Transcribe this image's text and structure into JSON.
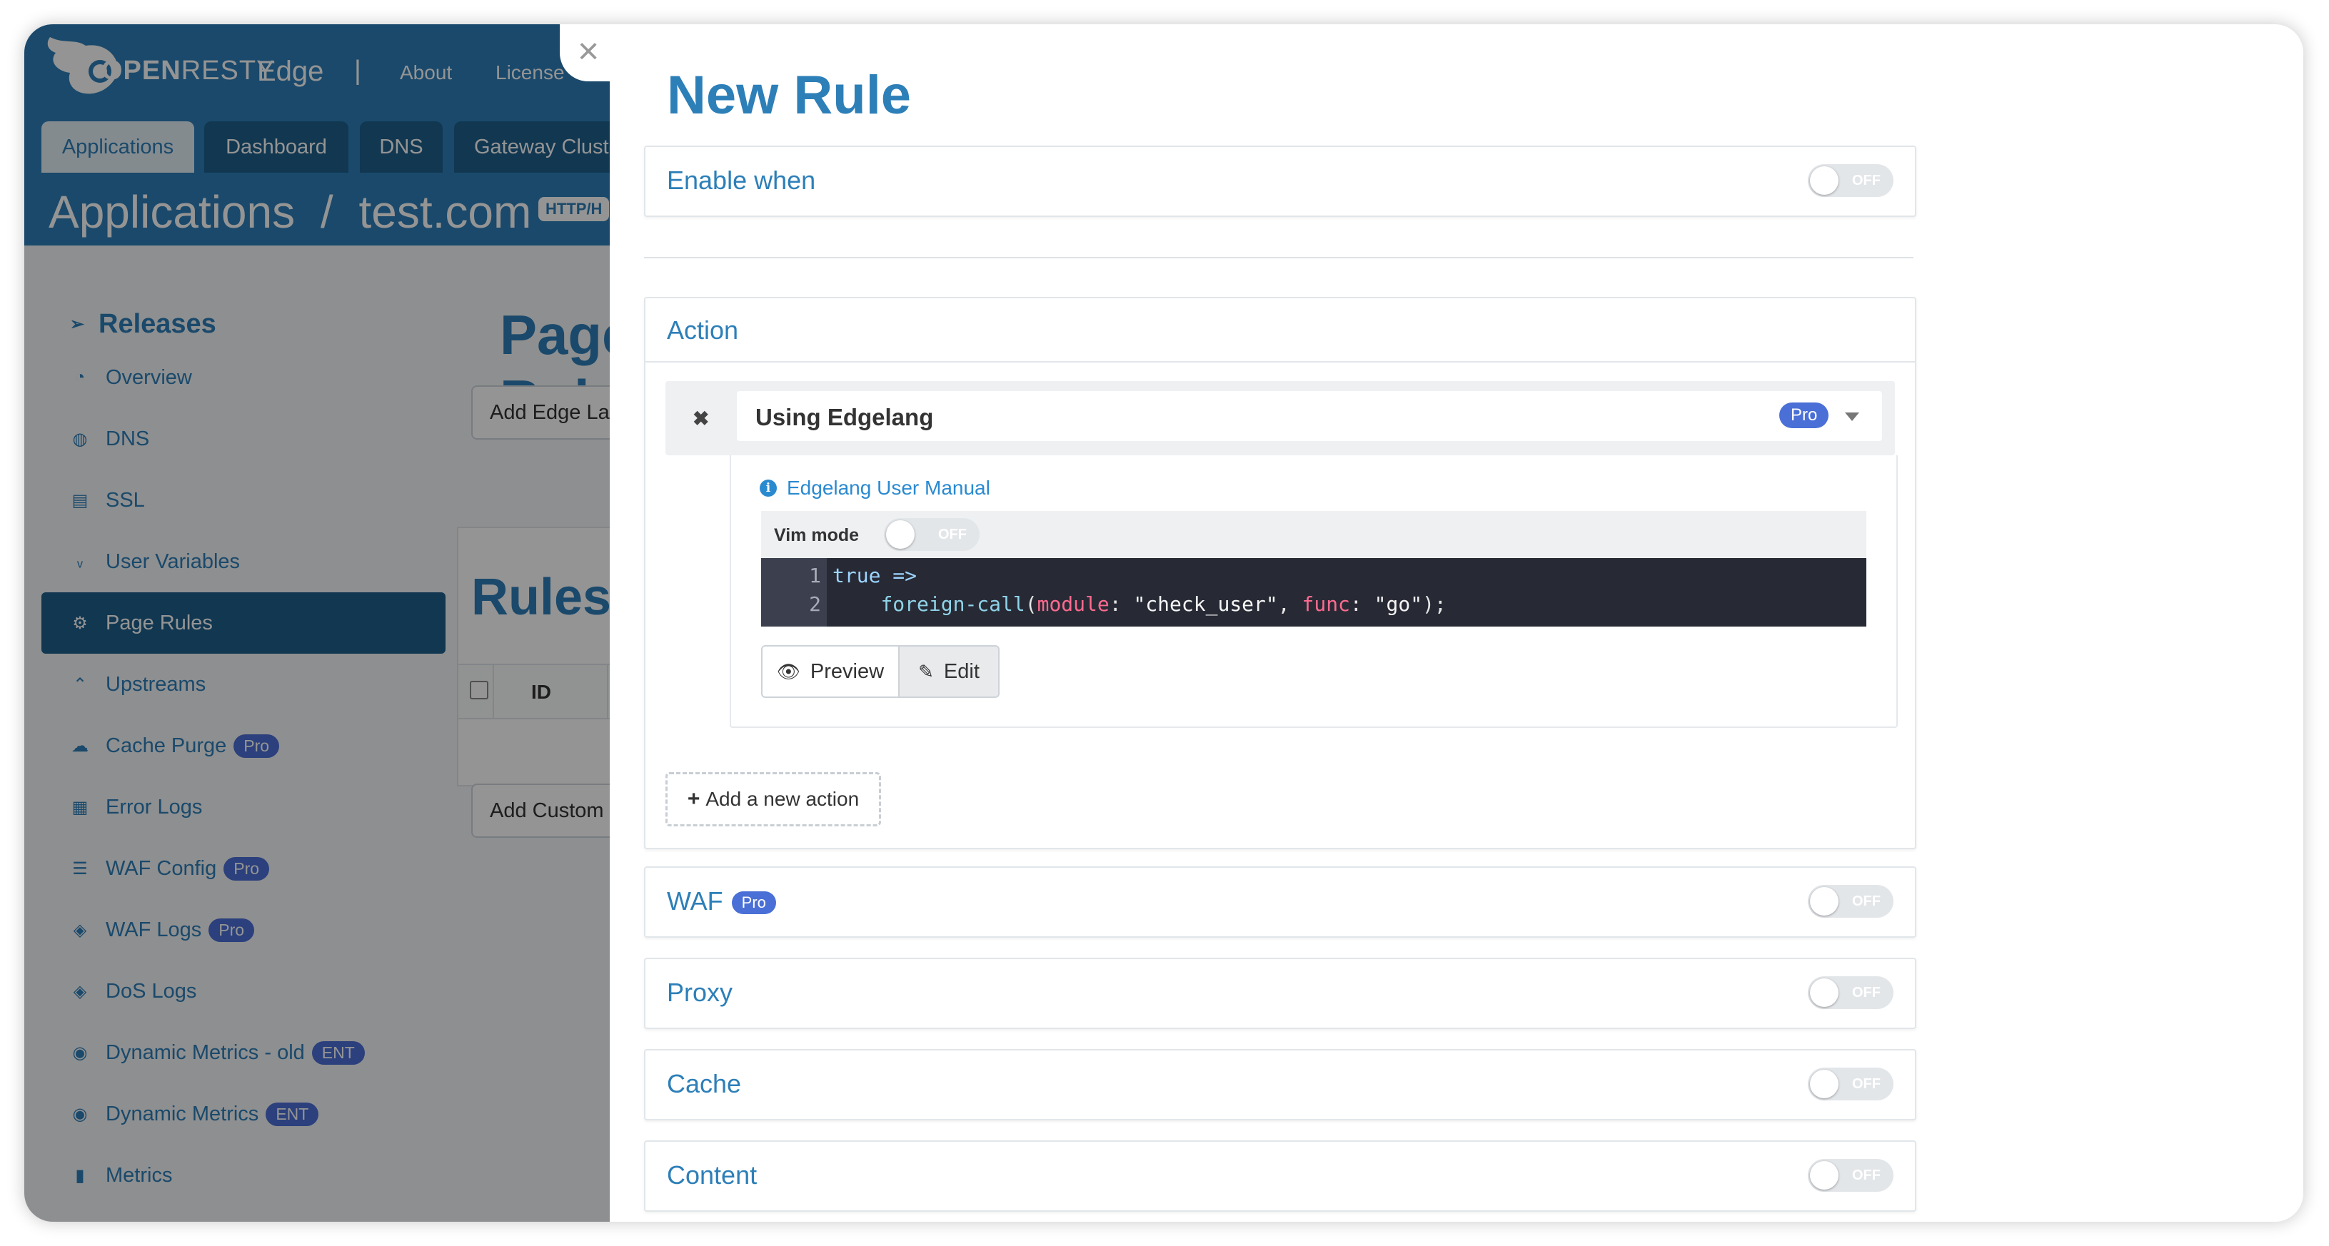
{
  "app": {
    "logo_bold": "OPEN",
    "logo_light": "RESTY",
    "logo_edge": "Edge",
    "separator": "|",
    "nav": {
      "about": "About",
      "license": "License"
    },
    "tabs": [
      "Applications",
      "Dashboard",
      "DNS",
      "Gateway Cluster"
    ],
    "breadcrumb": {
      "root": "Applications",
      "sep": "/",
      "app": "test.com",
      "protocol": "HTTP/H"
    },
    "page_title": "Page Rules",
    "buttons": {
      "add_edge": "Add Edge Language",
      "add_custom": "Add Custom"
    },
    "rules_title": "Rules",
    "rules_table": {
      "col_id": "ID"
    },
    "sidebar": {
      "header": "Releases",
      "items": [
        {
          "label": "Overview",
          "icon": "gauge-icon"
        },
        {
          "label": "DNS",
          "icon": "globe-icon"
        },
        {
          "label": "SSL",
          "icon": "certificate-icon"
        },
        {
          "label": "User Variables",
          "icon": "var-icon"
        },
        {
          "label": "Page Rules",
          "icon": "gear-icon",
          "active": true
        },
        {
          "label": "Upstreams",
          "icon": "upstream-icon"
        },
        {
          "label": "Cache Purge",
          "icon": "cloud-icon",
          "badge": "Pro"
        },
        {
          "label": "Error Logs",
          "icon": "log-icon"
        },
        {
          "label": "WAF Config",
          "icon": "list-icon",
          "badge": "Pro"
        },
        {
          "label": "WAF Logs",
          "icon": "shield-log-icon",
          "badge": "Pro"
        },
        {
          "label": "DoS Logs",
          "icon": "shield-log-icon"
        },
        {
          "label": "Dynamic Metrics - old",
          "icon": "target-icon",
          "badge": "ENT"
        },
        {
          "label": "Dynamic Metrics",
          "icon": "target-icon",
          "badge": "ENT"
        },
        {
          "label": "Metrics",
          "icon": "bar-chart-icon"
        }
      ]
    }
  },
  "drawer": {
    "close": "×",
    "title": "New Rule",
    "enable_when": {
      "label": "Enable when",
      "toggle": "OFF"
    },
    "action": {
      "label": "Action",
      "remove": "✖",
      "type": "Using Edgelang",
      "type_badge": "Pro",
      "manual_icon": "i",
      "manual": "Edgelang User Manual",
      "vim_label": "Vim mode",
      "vim_toggle": "OFF",
      "code": {
        "line1_no": "1",
        "line2_no": "2",
        "kw_true": "true",
        "arrow": " =>",
        "indent": "    ",
        "fn": "foreign-call",
        "open": "(",
        "p1": "module",
        "colon1": ": ",
        "v1": "\"check_user\"",
        "comma": ", ",
        "p2": "func",
        "colon2": ": ",
        "v2": "\"go\"",
        "close": ");"
      },
      "preview": "Preview",
      "edit": "Edit",
      "add_action": "Add a new action"
    },
    "sections": [
      {
        "label": "WAF",
        "badge": "Pro",
        "toggle": "OFF"
      },
      {
        "label": "Proxy",
        "toggle": "OFF"
      },
      {
        "label": "Cache",
        "toggle": "OFF"
      },
      {
        "label": "Content",
        "toggle": "OFF"
      }
    ]
  },
  "colors": {
    "brand": "#2d7fb8",
    "nav_dark": "#1e5f8c",
    "pro_badge": "#4a6fd6",
    "editor_bg": "#272a35",
    "link": "#2a8ad0"
  }
}
